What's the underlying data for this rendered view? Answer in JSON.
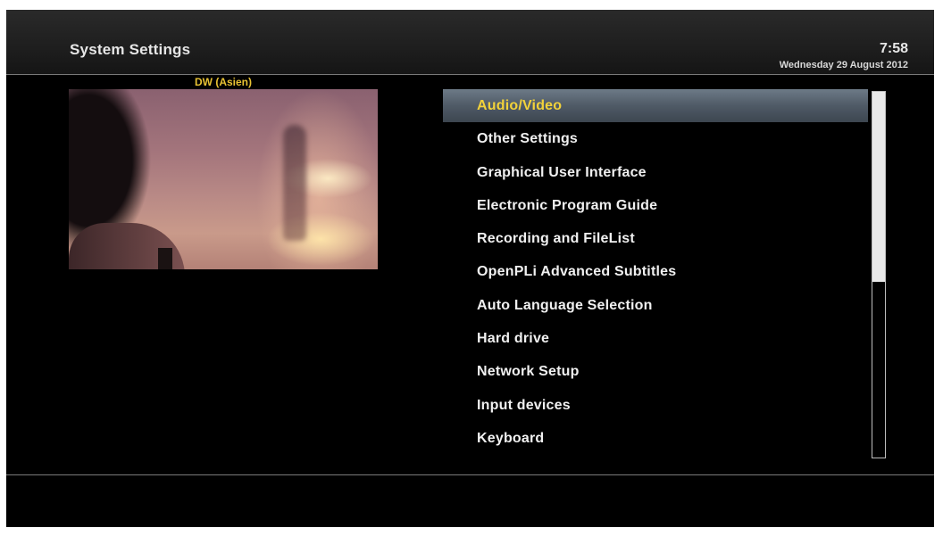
{
  "header": {
    "title": "System Settings",
    "time": "7:58",
    "date": "Wednesday 29 August 2012"
  },
  "preview": {
    "channel_name": "DW (Asien)"
  },
  "menu": {
    "selected_index": 0,
    "items": [
      {
        "label": "Audio/Video"
      },
      {
        "label": "Other Settings"
      },
      {
        "label": "Graphical User Interface"
      },
      {
        "label": "Electronic Program Guide"
      },
      {
        "label": "Recording and FileList"
      },
      {
        "label": "OpenPLi Advanced Subtitles"
      },
      {
        "label": "Auto Language Selection"
      },
      {
        "label": "Hard drive"
      },
      {
        "label": "Network Setup"
      },
      {
        "label": "Input devices"
      },
      {
        "label": "Keyboard"
      }
    ]
  },
  "scrollbar": {
    "position_fraction": 0.0,
    "visible_fraction": 0.52
  },
  "colors": {
    "background": "#000000",
    "selection_text": "#f2d23a",
    "channel_name": "#e8c233",
    "text": "#f0f0f0"
  }
}
